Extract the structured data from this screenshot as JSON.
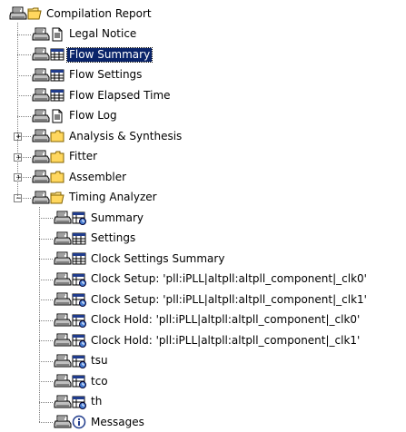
{
  "tree": {
    "root": {
      "label": "Compilation Report",
      "icon": "folder-open-icon"
    },
    "items": [
      {
        "label": "Legal Notice",
        "icon": "document-icon"
      },
      {
        "label": "Flow Summary",
        "icon": "table-icon",
        "selected": true
      },
      {
        "label": "Flow Settings",
        "icon": "table-icon"
      },
      {
        "label": "Flow Elapsed Time",
        "icon": "table-icon"
      },
      {
        "label": "Flow Log",
        "icon": "document-icon"
      },
      {
        "label": "Analysis & Synthesis",
        "icon": "folder-icon",
        "expander": "+"
      },
      {
        "label": "Fitter",
        "icon": "folder-icon",
        "expander": "+"
      },
      {
        "label": "Assembler",
        "icon": "folder-icon",
        "expander": "+"
      },
      {
        "label": "Timing Analyzer",
        "icon": "folder-open-icon",
        "expander": "-"
      }
    ],
    "timing_children": [
      {
        "label": "Summary",
        "icon": "timing-table-icon"
      },
      {
        "label": "Settings",
        "icon": "table-icon"
      },
      {
        "label": "Clock Settings Summary",
        "icon": "table-icon"
      },
      {
        "label": "Clock Setup: 'pll:iPLL|altpll:altpll_component|_clk0'",
        "icon": "timing-table-icon"
      },
      {
        "label": "Clock Setup: 'pll:iPLL|altpll:altpll_component|_clk1'",
        "icon": "timing-table-icon"
      },
      {
        "label": "Clock Hold: 'pll:iPLL|altpll:altpll_component|_clk0'",
        "icon": "timing-table-icon"
      },
      {
        "label": "Clock Hold: 'pll:iPLL|altpll:altpll_component|_clk1'",
        "icon": "timing-table-icon"
      },
      {
        "label": "tsu",
        "icon": "timing-table-icon"
      },
      {
        "label": "tco",
        "icon": "timing-table-icon"
      },
      {
        "label": "th",
        "icon": "timing-table-icon"
      },
      {
        "label": "Messages",
        "icon": "info-icon"
      }
    ]
  }
}
